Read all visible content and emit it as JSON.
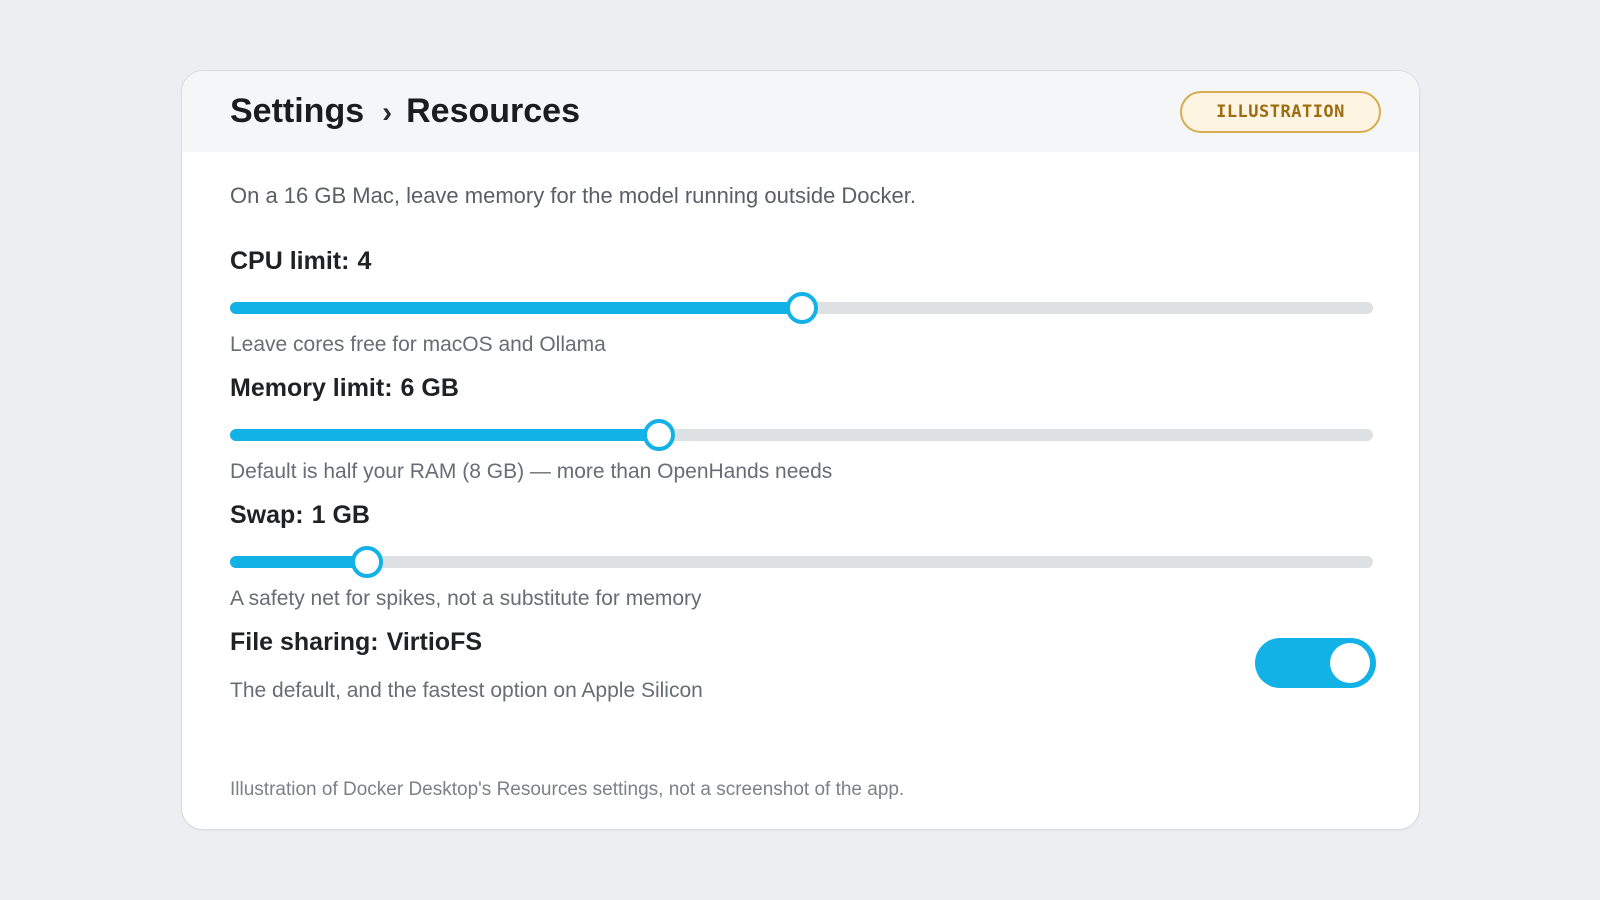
{
  "breadcrumb": {
    "root": "Settings",
    "separator": "›",
    "current": "Resources"
  },
  "badge": "ILLUSTRATION",
  "intro": "On a 16 GB Mac, leave memory for the model running outside Docker.",
  "settings": {
    "cpu": {
      "label": "CPU limit:",
      "value": "4",
      "hint": "Leave cores free for macOS and Ollama",
      "fraction": 0.5
    },
    "memory": {
      "label": "Memory limit:",
      "value": "6 GB",
      "hint": "Default is half your RAM (8 GB) — more than OpenHands needs",
      "fraction": 0.375
    },
    "swap": {
      "label": "Swap:",
      "value": "1 GB",
      "hint": "A safety net for spikes, not a substitute for memory",
      "fraction": 0.12
    },
    "file_sharing": {
      "label": "File sharing:",
      "value": "VirtioFS",
      "hint": "The default, and the fastest option on Apple Silicon",
      "enabled": true
    }
  },
  "footnote": "Illustration of Docker Desktop's Resources settings, not a screenshot of the app.",
  "colors": {
    "accent": "#13b2e6",
    "track": "#dee1e4",
    "badge_border": "#d8ad52",
    "badge_text": "#9c6c12"
  }
}
